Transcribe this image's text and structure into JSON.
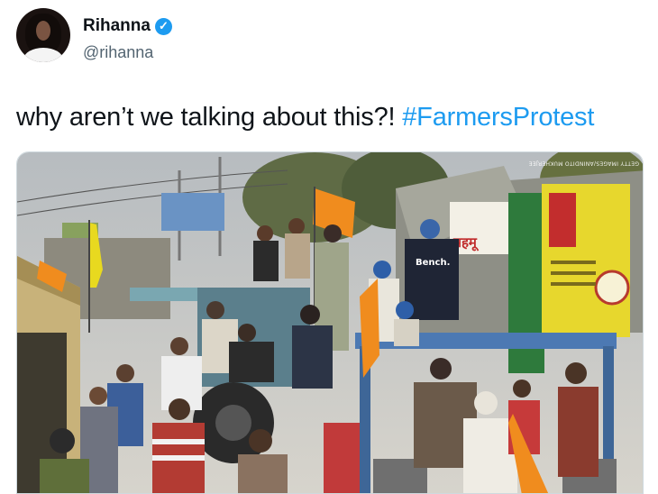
{
  "author": {
    "display_name": "Rihanna",
    "handle": "@rihanna",
    "verified_icon": "verified-badge-icon",
    "verified_glyph": "✓"
  },
  "tweet": {
    "text": "why aren’t we talking about this?!",
    "hashtag": "#FarmersProtest"
  },
  "media": {
    "photo_signs": {
      "bench_shirt": "Bench.",
      "shop_banner": "महमू",
      "watermark": "GETTY IMAGES/ANINDITO MUKHERJEE"
    }
  },
  "colors": {
    "link_blue": "#1d9bf0",
    "handle_gray": "#536471",
    "text": "#0f1419"
  }
}
